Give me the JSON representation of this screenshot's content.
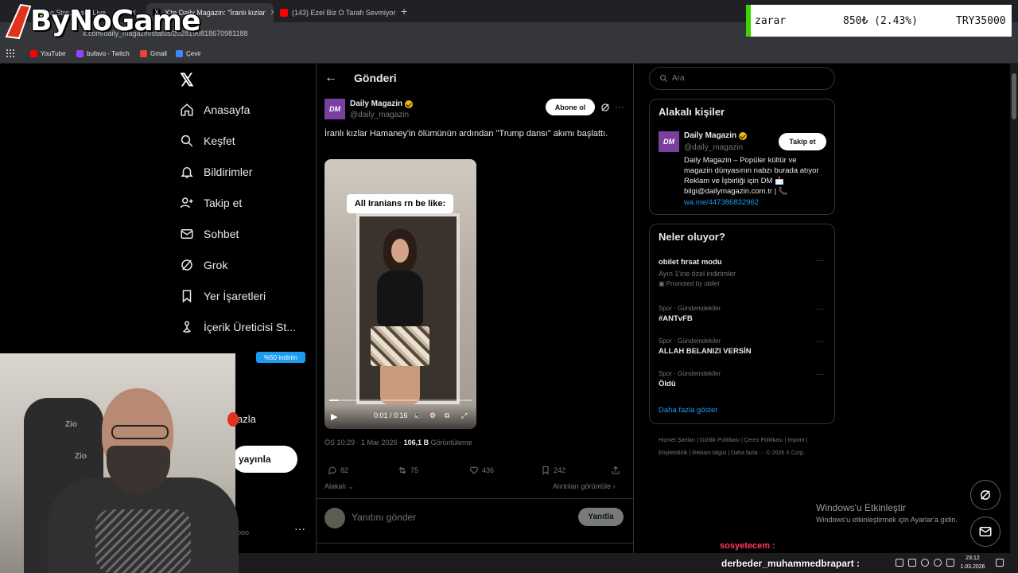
{
  "browser": {
    "tabs": [
      {
        "label": "o Stre... atch Live"
      },
      {
        "label": "X'te Daily Magazin: \"İranlı kızlar"
      },
      {
        "label": "(143) Ezel Biz O Tarafı Sevmiyor"
      }
    ],
    "url": "x.com/daily_magazin/status/2028190818670981188",
    "bookmarks": [
      {
        "label": "YouTube",
        "color": "#ff0000"
      },
      {
        "label": "bufavo - Twitch",
        "color": "#9146ff"
      },
      {
        "label": "Gmail",
        "color": "#ea4335"
      },
      {
        "label": "Çevir",
        "color": "#4285f4"
      }
    ]
  },
  "overlay": {
    "logo_text": "ByNoGame",
    "ticker": {
      "label": "zarar",
      "change": "850₺ (2.43%)",
      "balance": "TRY35000"
    }
  },
  "nav": {
    "items": [
      {
        "label": "Anasayfa",
        "icon": "home-icon"
      },
      {
        "label": "Keşfet",
        "icon": "search-icon"
      },
      {
        "label": "Bildirimler",
        "icon": "bell-icon"
      },
      {
        "label": "Takip et",
        "icon": "follow-icon"
      },
      {
        "label": "Sohbet",
        "icon": "mail-icon"
      },
      {
        "label": "Grok",
        "icon": "grok-icon"
      },
      {
        "label": "Yer İşaretleri",
        "icon": "bookmark-icon"
      },
      {
        "label": "İçerik Üreticisi St...",
        "icon": "creator-icon"
      }
    ],
    "promo_badge": "%50 indirim",
    "more_label": "azla",
    "post_button": "yayınla",
    "profile_suffix": "ooo"
  },
  "post": {
    "page_title": "Gönderi",
    "avatar_text": "DM",
    "author_name": "Daily Magazin",
    "author_handle": "@daily_magazin",
    "subscribe_label": "Abone ol",
    "text": "İranlı kızlar Hamaney'in ölümünün ardından \"Trump dansı\" akımı başlattı.",
    "video_caption": "All Iranians rn be like:",
    "video_time": "0:01 / 0:16",
    "video_progress": 0.0625,
    "meta_time": "ÖS 10:29 · 1 Mar 2026 · ",
    "views_count": "106,1 B",
    "views_label": " Görüntüleme",
    "replies": "82",
    "reposts": "75",
    "likes": "436",
    "bookmarks": "242",
    "related_label": "Alakalı",
    "quotes_label": "Alıntıları görüntüle",
    "reply_placeholder": "Yanıtını gönder",
    "reply_button": "Yanıtla"
  },
  "sidebar": {
    "search_placeholder": "Ara",
    "related": {
      "title": "Alakalı kişiler",
      "avatar_text": "DM",
      "name": "Daily Magazin",
      "handle": "@daily_magazin",
      "follow_label": "Takip et",
      "bio": "Daily Magazin – Popüler kültür ve magazin dünyasının nabzı burada atıyor Reklam ve İşbirliği için DM 📩 bilgi@dailymagazin.com.tr | 📞",
      "link": "wa.me/447386832962"
    },
    "trends": {
      "title": "Neler oluyor?",
      "items": [
        {
          "name": "obilet fırsat modu",
          "sub": "Ayın 1'ine özel indirimler",
          "promoted": "Promoted by obilet"
        },
        {
          "category": "Spor · Gündemdekiler",
          "name": "#ANTvFB"
        },
        {
          "category": "Spor · Gündemdekiler",
          "name": "ALLAH BELANIZI VERSİN"
        },
        {
          "category": "Spor · Gündemdekiler",
          "name": "Öldü"
        }
      ],
      "show_more": "Daha fazla göster"
    },
    "footer": "Hizmet Şartları | Gizlilik Politikası | Çerez Politikası | Imprint | Erişilebilirlik | Reklam bilgisi | Daha fazla ··· © 2026 X Corp."
  },
  "windows": {
    "activate_title": "Windows'u Etkinleştir",
    "activate_sub": "Windows'u etkinleştirmek için Ayarlar'a gidin.",
    "time": "23:12",
    "date": "1.03.2026"
  },
  "chat": {
    "line1": "sosyetecem :",
    "line2": "derbeder_muhammedbrapart :"
  }
}
